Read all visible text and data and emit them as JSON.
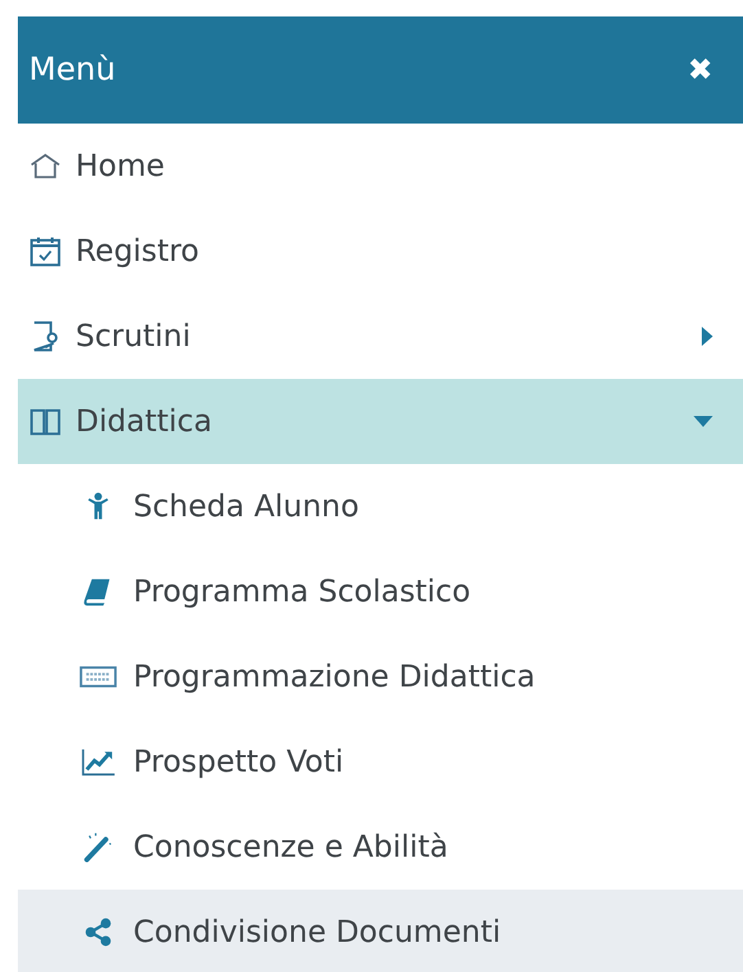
{
  "header": {
    "title": "Menù",
    "close": "✖"
  },
  "items": [
    {
      "kind": "link",
      "label": "Home"
    },
    {
      "kind": "link",
      "label": "Registro"
    },
    {
      "kind": "group",
      "label": "Scrutini",
      "expanded": false
    },
    {
      "kind": "group",
      "label": "Didattica",
      "expanded": true,
      "children": [
        {
          "label": "Scheda Alunno",
          "selected": false
        },
        {
          "label": "Programma Scolastico",
          "selected": false
        },
        {
          "label": "Programmazione Didattica",
          "selected": false
        },
        {
          "label": "Prospetto Voti",
          "selected": false
        },
        {
          "label": "Conoscenze e Abilità",
          "selected": false
        },
        {
          "label": "Condivisione Documenti",
          "selected": true
        }
      ]
    }
  ]
}
